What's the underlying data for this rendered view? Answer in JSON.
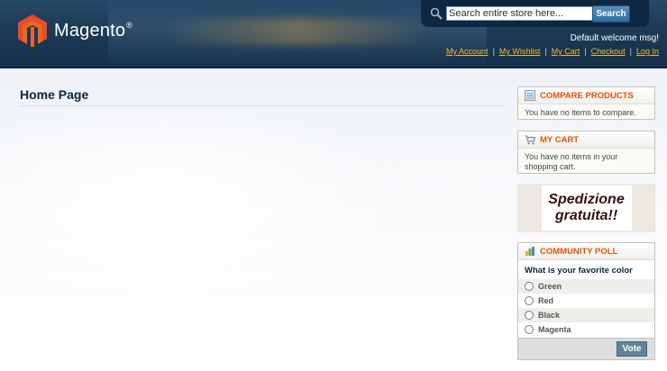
{
  "header": {
    "logo_text": "Magento",
    "logo_reg": "®",
    "search": {
      "placeholder": "Search entire store here...",
      "value": "Search entire store here...",
      "button_label": "Search"
    },
    "welcome": "Default welcome msg!",
    "links": [
      "My Account",
      "My Wishlist",
      "My Cart",
      "Checkout",
      "Log In"
    ]
  },
  "main": {
    "page_title": "Home Page"
  },
  "sidebar": {
    "compare": {
      "title": "COMPARE PRODUCTS",
      "content": "You have no items to compare."
    },
    "cart": {
      "title": "MY CART",
      "content": "You have no items in your shopping cart."
    },
    "promo": {
      "line1": "Spedizione",
      "line2": "gratuita!!"
    },
    "poll": {
      "title": "COMMUNITY POLL",
      "question": "What is your favorite color",
      "options": [
        "Green",
        "Red",
        "Black",
        "Magenta"
      ],
      "vote_label": "Vote"
    }
  },
  "colors": {
    "header_bg": "#1f3c58",
    "accent_orange": "#e25203",
    "link_gold": "#ebbb40",
    "logo_red": "#e34f27"
  },
  "icons": [
    "magento-logo-icon",
    "search-icon",
    "compare-icon",
    "cart-icon",
    "poll-icon"
  ]
}
